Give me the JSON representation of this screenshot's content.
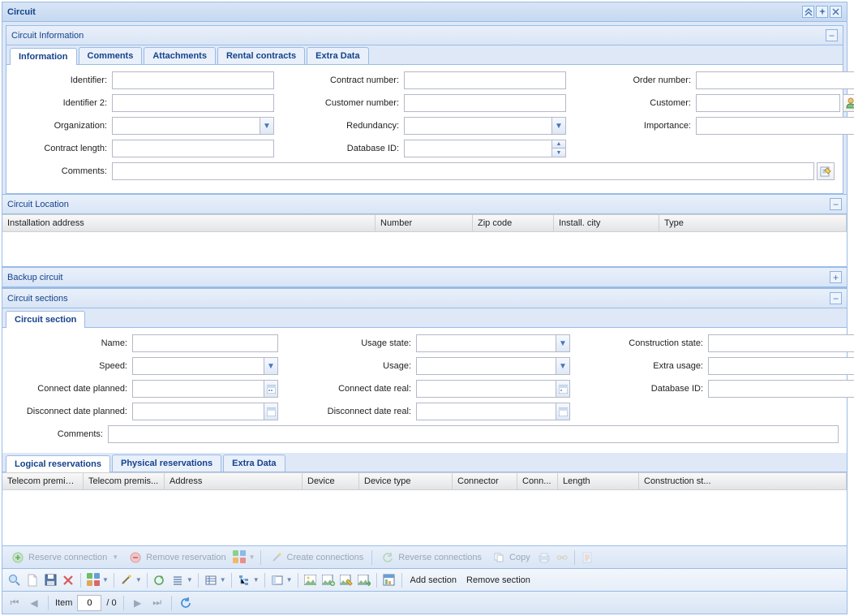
{
  "window": {
    "title": "Circuit"
  },
  "circuit_info": {
    "title": "Circuit Information",
    "tabs": [
      "Information",
      "Comments",
      "Attachments",
      "Rental contracts",
      "Extra Data"
    ],
    "labels": {
      "identifier": "Identifier:",
      "identifier2": "Identifier 2:",
      "organization": "Organization:",
      "contract_length": "Contract length:",
      "comments": "Comments:",
      "contract_number": "Contract number:",
      "customer_number": "Customer number:",
      "redundancy": "Redundancy:",
      "database_id": "Database ID:",
      "order_number": "Order number:",
      "customer": "Customer:",
      "importance": "Importance:"
    }
  },
  "circuit_location": {
    "title": "Circuit Location",
    "cols": [
      "Installation address",
      "Number",
      "Zip code",
      "Install. city",
      "Type"
    ]
  },
  "backup_circuit": {
    "title": "Backup circuit"
  },
  "circuit_sections": {
    "title": "Circuit sections",
    "tab": "Circuit section",
    "labels": {
      "name": "Name:",
      "speed": "Speed:",
      "connect_planned": "Connect date planned:",
      "disconnect_planned": "Disconnect date planned:",
      "comments": "Comments:",
      "usage_state": "Usage state:",
      "usage": "Usage:",
      "connect_real": "Connect date real:",
      "disconnect_real": "Disconnect date real:",
      "construction_state": "Construction state:",
      "extra_usage": "Extra usage:",
      "database_id": "Database ID:"
    },
    "res_tabs": [
      "Logical reservations",
      "Physical reservations",
      "Extra Data"
    ],
    "res_cols": [
      "Telecom premises",
      "Telecom premis...",
      "Address",
      "Device",
      "Device type",
      "Connector",
      "Conn...",
      "Length",
      "Construction st..."
    ]
  },
  "actions": {
    "reserve": "Reserve connection",
    "remove_res": "Remove reservation",
    "create": "Create connections",
    "reverse": "Reverse connections",
    "copy": "Copy",
    "add_section": "Add section",
    "remove_section": "Remove section"
  },
  "pager": {
    "item": "Item",
    "value": "0",
    "total": "/ 0"
  }
}
